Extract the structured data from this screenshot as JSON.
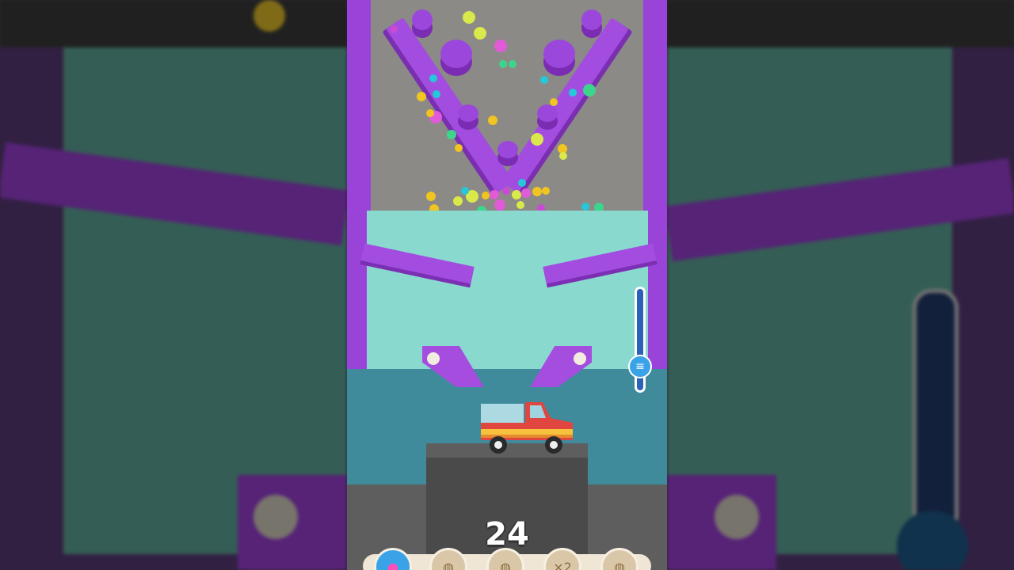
{
  "game": {
    "score": "24",
    "slider_menu_icon": "menu-lines-icon",
    "tray_items": [
      {
        "name": "boost-button",
        "icon": "pink-bomb-icon",
        "glyph": "●"
      },
      {
        "name": "item-slot-1",
        "icon": "balls-icon",
        "glyph": "◍"
      },
      {
        "name": "item-slot-2",
        "icon": "balls-icon",
        "glyph": "◍"
      },
      {
        "name": "item-slot-3",
        "icon": "multiplier-icon",
        "glyph": "×2"
      },
      {
        "name": "item-slot-4",
        "icon": "balls-icon",
        "glyph": "◍"
      }
    ]
  },
  "colors": {
    "purple": "#9a43d8",
    "water": "#8ad9cf",
    "truck_red": "#e0453f"
  }
}
